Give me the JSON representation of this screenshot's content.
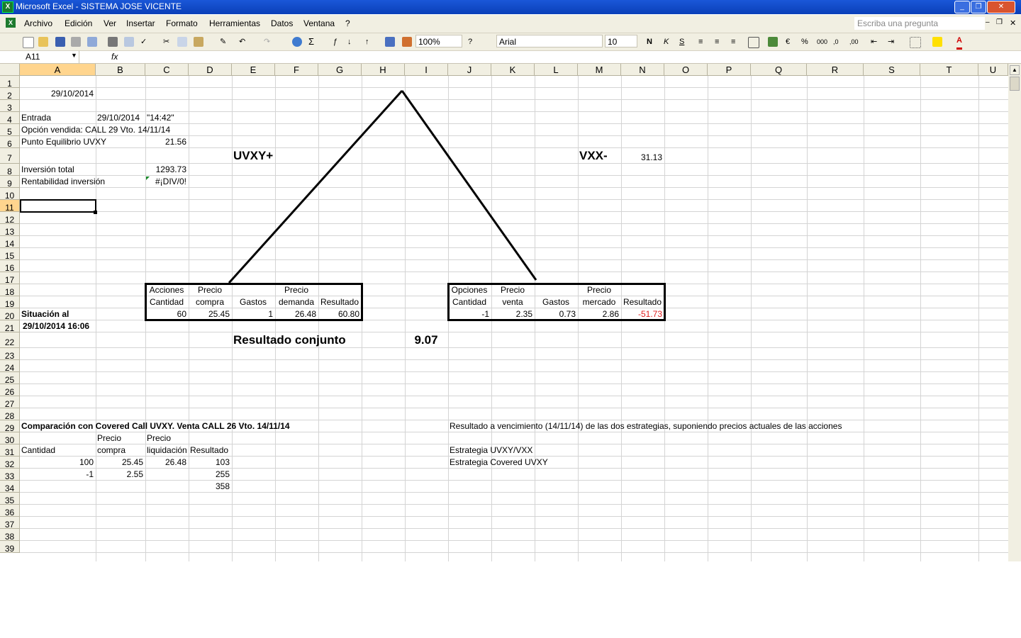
{
  "window": {
    "title": "Microsoft Excel - SISTEMA JOSE VICENTE"
  },
  "menu": {
    "items": [
      "Archivo",
      "Edición",
      "Ver",
      "Insertar",
      "Formato",
      "Herramientas",
      "Datos",
      "Ventana",
      "?"
    ],
    "ask_placeholder": "Escriba una pregunta"
  },
  "toolbar": {
    "zoom": "100%",
    "font": "Arial",
    "font_size": "10"
  },
  "formula_bar": {
    "name_box": "A11",
    "fx": "fx",
    "formula": ""
  },
  "columns": [
    "A",
    "B",
    "C",
    "D",
    "E",
    "F",
    "G",
    "H",
    "I",
    "J",
    "K",
    "L",
    "M",
    "N",
    "O",
    "P",
    "Q",
    "R",
    "S",
    "T",
    "U"
  ],
  "rows": [
    "1",
    "2",
    "3",
    "4",
    "5",
    "6",
    "7",
    "8",
    "9",
    "10",
    "11",
    "12",
    "13",
    "14",
    "15",
    "16",
    "17",
    "18",
    "19",
    "20",
    "21",
    "22",
    "23",
    "24",
    "25",
    "26",
    "27",
    "28",
    "29",
    "30",
    "31",
    "32",
    "33",
    "34",
    "35",
    "36",
    "37",
    "38",
    "39"
  ],
  "selected_cell": "A11",
  "cells": {
    "a2": "29/10/2014",
    "a4": "Entrada",
    "b4": "29/10/2014",
    "c4": "\"14:42\"",
    "a5": "Opción vendida: CALL 29 Vto. 14/11/14",
    "a6": "Punto Equilibrio UVXY",
    "c6": "21.56",
    "e7": "UVXY+",
    "m7": "VXX-",
    "n7": "31.13",
    "a8": "Inversión total",
    "c8": "1293.73",
    "a9": "Rentabilidad inversión",
    "c9": "#¡DIV/0!",
    "c18": "Acciones",
    "d18": "Precio",
    "f18": "Precio",
    "c19": "Cantidad",
    "d19": "compra",
    "e19": "Gastos",
    "f19": "demanda",
    "g19": "Resultado",
    "a20": "Situación al",
    "c20": "60",
    "d20": "25.45",
    "e20": "1",
    "f20": "26.48",
    "g20": "60.80",
    "j18": "Opciones",
    "k18": "Precio",
    "m18": "Precio",
    "j19": "Cantidad",
    "k19": "venta",
    "l19": "Gastos",
    "m19": "mercado",
    "n19": "Resultado",
    "j20": "-1",
    "k20": "2.35",
    "l20": "0.73",
    "m20": "2.86",
    "n20": "-51.73",
    "a21": "29/10/2014 16:06",
    "e22": "Resultado conjunto",
    "i22": "9.07",
    "a29": "Comparación con Covered Call UVXY. Venta CALL 26 Vto. 14/11/14",
    "j29": "Resultado a vencimiento (14/11/14) de las dos estrategias, suponiendo precios actuales de las acciones",
    "b30": "Precio",
    "c30": "Precio",
    "a31": "Cantidad",
    "b31": "compra",
    "c31": "liquidación",
    "d31": "Resultado",
    "j31": "Estrategia UVXY/VXX",
    "a32": "100",
    "b32": "25.45",
    "c32": "26.48",
    "d32": "103",
    "j32": "Estrategia Covered UVXY",
    "a33": "-1",
    "b33": "2.55",
    "d33": "255",
    "d34": "358"
  },
  "colors": {
    "title_bar": "#1a57d8",
    "chrome": "#f1efe2",
    "header_selected": "#ffd58e",
    "negative": "#e02020"
  }
}
